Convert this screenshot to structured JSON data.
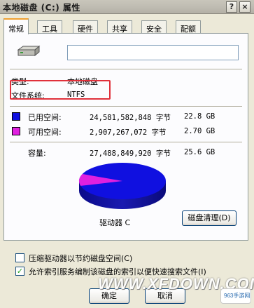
{
  "window": {
    "title": "本地磁盘 (C:) 属性",
    "help_label": "?",
    "close_label": "×"
  },
  "tabs": [
    {
      "label": "常规",
      "active": true
    },
    {
      "label": "工具"
    },
    {
      "label": "硬件"
    },
    {
      "label": "共享"
    },
    {
      "label": "安全"
    },
    {
      "label": "配额"
    }
  ],
  "general": {
    "volume_name": "",
    "type_label": "类型:",
    "type_value": "本地磁盘",
    "fs_label": "文件系统:",
    "fs_value": "NTFS",
    "used_label": "已用空间:",
    "used_bytes": "24,581,582,848 字节",
    "used_size": "22.8 GB",
    "free_label": "可用空间:",
    "free_bytes": "2,907,267,072 字节",
    "free_size": "2.70 GB",
    "capacity_label": "容量:",
    "capacity_bytes": "27,488,849,920 字节",
    "capacity_size": "25.6 GB",
    "drive_label": "驱动器 C",
    "cleanup_button": "磁盘清理(D)",
    "compress_label": "压缩驱动器以节约磁盘空间(C)",
    "compress_checked": false,
    "index_label": "允许索引服务编制该磁盘的索引以便快速搜索文件(I)",
    "index_checked": true
  },
  "colors": {
    "used": "#1010e0",
    "free": "#e020e0",
    "highlight": "#e0303a"
  },
  "buttons": {
    "ok": "确定",
    "cancel": "取消"
  },
  "watermark": {
    "text": "WWW.XFDOWN.COM",
    "badge": "963手游网"
  }
}
